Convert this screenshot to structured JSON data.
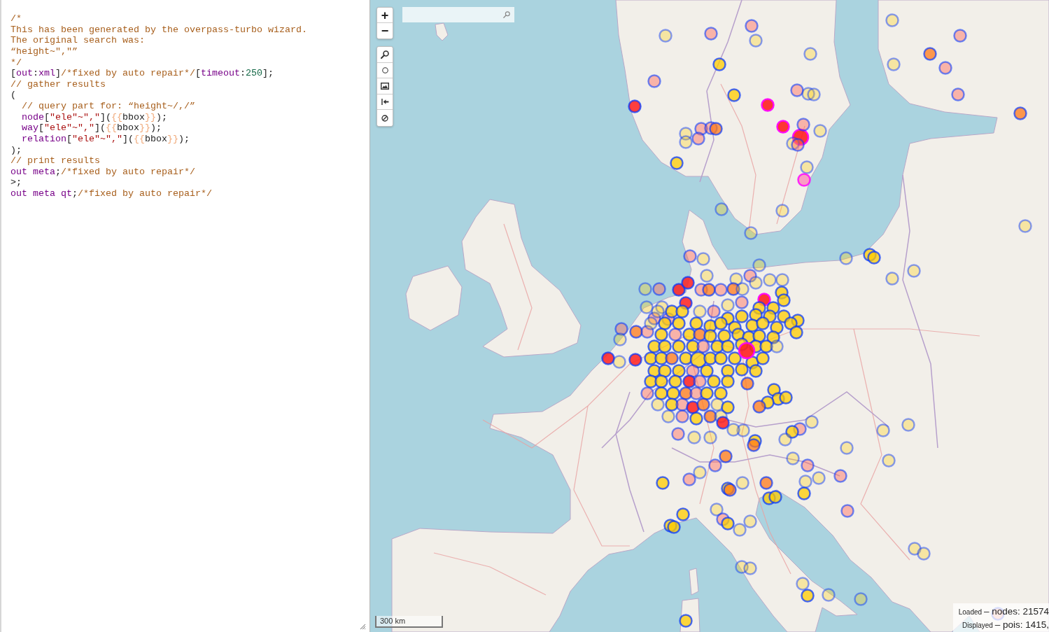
{
  "editor": {
    "lines": [
      [
        {
          "text": "/*",
          "kind": "comment"
        }
      ],
      [
        {
          "text": "This has been generated by the overpass-turbo wizard.",
          "kind": "comment"
        }
      ],
      [
        {
          "text": "The original search was:",
          "kind": "comment"
        }
      ],
      [
        {
          "text": "“height~\",\"”",
          "kind": "comment"
        }
      ],
      [
        {
          "text": "*/",
          "kind": "comment"
        }
      ],
      [
        {
          "text": "[",
          "kind": "plain"
        },
        {
          "text": "out",
          "kind": "keyword"
        },
        {
          "text": ":",
          "kind": "plain"
        },
        {
          "text": "xml",
          "kind": "keyword"
        },
        {
          "text": "]",
          "kind": "plain"
        },
        {
          "text": "/*fixed by auto repair*/",
          "kind": "comment"
        },
        {
          "text": "[",
          "kind": "plain"
        },
        {
          "text": "timeout",
          "kind": "keyword"
        },
        {
          "text": ":",
          "kind": "plain"
        },
        {
          "text": "250",
          "kind": "number"
        },
        {
          "text": "];",
          "kind": "plain"
        }
      ],
      [
        {
          "text": "// gather results",
          "kind": "comment"
        }
      ],
      [
        {
          "text": "(",
          "kind": "plain"
        }
      ],
      [
        {
          "text": "  // query part for: “height~/,/”",
          "kind": "comment"
        }
      ],
      [
        {
          "text": "  node",
          "kind": "keyword"
        },
        {
          "text": "[",
          "kind": "plain"
        },
        {
          "text": "\"ele\"~\",\"",
          "kind": "string"
        },
        {
          "text": "](",
          "kind": "plain"
        },
        {
          "text": "{{",
          "kind": "shortcut"
        },
        {
          "text": "bbox",
          "kind": "plain"
        },
        {
          "text": "}}",
          "kind": "shortcut"
        },
        {
          "text": ");",
          "kind": "plain"
        }
      ],
      [
        {
          "text": "  way",
          "kind": "keyword"
        },
        {
          "text": "[",
          "kind": "plain"
        },
        {
          "text": "\"ele\"~\",\"",
          "kind": "string"
        },
        {
          "text": "](",
          "kind": "plain"
        },
        {
          "text": "{{",
          "kind": "shortcut"
        },
        {
          "text": "bbox",
          "kind": "plain"
        },
        {
          "text": "}}",
          "kind": "shortcut"
        },
        {
          "text": ");",
          "kind": "plain"
        }
      ],
      [
        {
          "text": "  relation",
          "kind": "keyword"
        },
        {
          "text": "[",
          "kind": "plain"
        },
        {
          "text": "\"ele\"~\",\"",
          "kind": "string"
        },
        {
          "text": "](",
          "kind": "plain"
        },
        {
          "text": "{{",
          "kind": "shortcut"
        },
        {
          "text": "bbox",
          "kind": "plain"
        },
        {
          "text": "}}",
          "kind": "shortcut"
        },
        {
          "text": ");",
          "kind": "plain"
        }
      ],
      [
        {
          "text": ");",
          "kind": "plain"
        }
      ],
      [
        {
          "text": "// print results",
          "kind": "comment"
        }
      ],
      [
        {
          "text": "out meta",
          "kind": "keyword"
        },
        {
          "text": ";",
          "kind": "plain"
        },
        {
          "text": "/*fixed by auto repair*/",
          "kind": "comment"
        }
      ],
      [
        {
          "text": ">;",
          "kind": "plain"
        }
      ],
      [
        {
          "text": "out meta qt",
          "kind": "keyword"
        },
        {
          "text": ";",
          "kind": "plain"
        },
        {
          "text": "/*fixed by auto repair*/",
          "kind": "comment"
        }
      ]
    ]
  },
  "map": {
    "zoom_buttons": [
      "+",
      "−"
    ],
    "scale": "300 km",
    "status": [
      {
        "label": "Loaded",
        "value": "– nodes: 21574"
      },
      {
        "label": "Displayed",
        "value": "– pois: 1415,"
      }
    ]
  }
}
